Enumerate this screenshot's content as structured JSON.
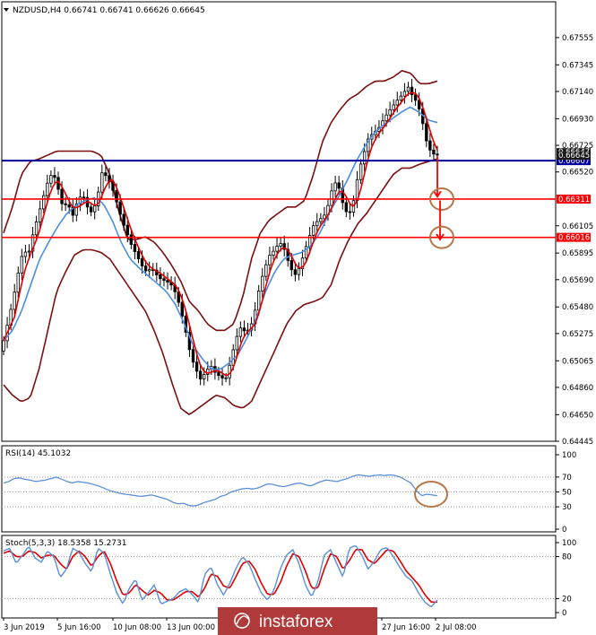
{
  "header": {
    "symbol_line": "NZDUSD,H4  0.66741 0.66741 0.66626 0.66645",
    "rsi_label": "RSI(14) 45.1032",
    "stoch_label": "Stoch(5,3,3) 18.5358 15.2731"
  },
  "watermark": "instaforex",
  "colors": {
    "candle": "#000000",
    "bollinger": "#7a1010",
    "ma_fast": "#e00000",
    "ma_slow": "#4a8fe0",
    "level_blue": "#00009c",
    "level_red": "#ff0000",
    "rsi_line": "#5b8fd8",
    "stoch_main": "#5b8fd8",
    "stoch_signal": "#e00000",
    "annotation": "#b5774a",
    "watermark_bg": "#b03a3a"
  },
  "chart_data": [
    {
      "type": "candlestick",
      "title": "NZDUSD,H4",
      "ylim": [
        0.64445,
        0.67665
      ],
      "y_ticks": [
        "0.67555",
        "0.67345",
        "0.67140",
        "0.66930",
        "0.66725",
        "0.66520",
        "0.66105",
        "0.65895",
        "0.65690",
        "0.65480",
        "0.65275",
        "0.65065",
        "0.64860",
        "0.64650",
        "0.64445"
      ],
      "x_ticks": [
        "3 Jun 2019",
        "5 Jun 16:00",
        "10 Jun 08:00",
        "13 Jun 00:00",
        "27 Jun 16:00",
        "2 Jul 08:00"
      ],
      "current_price": [
        "0.66647",
        "0.66645"
      ],
      "levels": [
        {
          "label": "0.66607",
          "price": 0.66607,
          "color": "blue"
        },
        {
          "label": "0.66311",
          "price": 0.66311,
          "color": "red"
        },
        {
          "label": "0.66016",
          "price": 0.66016,
          "color": "red"
        }
      ],
      "close_path": [
        0.6522,
        0.6538,
        0.6555,
        0.6575,
        0.6592,
        0.6588,
        0.6605,
        0.6618,
        0.6632,
        0.6645,
        0.6652,
        0.664,
        0.6625,
        0.6628,
        0.6618,
        0.663,
        0.6635,
        0.6625,
        0.662,
        0.6632,
        0.6652,
        0.6648,
        0.664,
        0.6628,
        0.6615,
        0.6605,
        0.6595,
        0.6588,
        0.658,
        0.6575,
        0.6578,
        0.6573,
        0.6569,
        0.6568,
        0.6565,
        0.6558,
        0.6545,
        0.6528,
        0.651,
        0.65,
        0.6492,
        0.6498,
        0.6503,
        0.6497,
        0.6494,
        0.6492,
        0.6505,
        0.6522,
        0.6532,
        0.6529,
        0.6531,
        0.6545,
        0.6565,
        0.6578,
        0.6588,
        0.6592,
        0.6598,
        0.6592,
        0.658,
        0.6572,
        0.6578,
        0.659,
        0.6602,
        0.6612,
        0.6615,
        0.6618,
        0.6628,
        0.6645,
        0.664,
        0.6625,
        0.6618,
        0.663,
        0.6652,
        0.6665,
        0.6678,
        0.6682,
        0.6685,
        0.6692,
        0.6698,
        0.6703,
        0.6708,
        0.6712,
        0.6718,
        0.671,
        0.6705,
        0.669,
        0.6672,
        0.6666,
        0.6665
      ],
      "bb_upper_path": [
        0.6605,
        0.6625,
        0.665,
        0.666,
        0.6662,
        0.6665,
        0.6668,
        0.6668,
        0.6668,
        0.6668,
        0.6668,
        0.6665,
        0.665,
        0.6622,
        0.66,
        0.66,
        0.6602,
        0.6598,
        0.659,
        0.658,
        0.6568,
        0.6552,
        0.6545,
        0.6535,
        0.653,
        0.653,
        0.6535,
        0.6555,
        0.6585,
        0.6605,
        0.6615,
        0.662,
        0.6625,
        0.6625,
        0.663,
        0.665,
        0.6675,
        0.669,
        0.67,
        0.6708,
        0.6712,
        0.6718,
        0.6722,
        0.6722,
        0.6725,
        0.673,
        0.6728,
        0.672,
        0.672,
        0.6722
      ],
      "bb_lower_path": [
        0.6488,
        0.648,
        0.6475,
        0.6478,
        0.65,
        0.653,
        0.656,
        0.6575,
        0.6588,
        0.6592,
        0.6592,
        0.659,
        0.6585,
        0.6575,
        0.6565,
        0.6555,
        0.6545,
        0.653,
        0.6512,
        0.649,
        0.647,
        0.6465,
        0.647,
        0.6475,
        0.648,
        0.6478,
        0.6472,
        0.647,
        0.6475,
        0.649,
        0.6505,
        0.652,
        0.6535,
        0.6545,
        0.655,
        0.6552,
        0.6555,
        0.6565,
        0.6585,
        0.66,
        0.6612,
        0.662,
        0.663,
        0.664,
        0.665,
        0.6655,
        0.6655,
        0.6658,
        0.666,
        0.6662
      ],
      "ma_slow_path": [
        0.6522,
        0.653,
        0.6545,
        0.6565,
        0.6585,
        0.6598,
        0.661,
        0.662,
        0.6626,
        0.663,
        0.6632,
        0.6628,
        0.6615,
        0.6598,
        0.6585,
        0.6578,
        0.6572,
        0.6566,
        0.656,
        0.655,
        0.6535,
        0.6518,
        0.6508,
        0.65,
        0.65,
        0.6505,
        0.6512,
        0.6525,
        0.654,
        0.656,
        0.6575,
        0.6585,
        0.6588,
        0.659,
        0.6595,
        0.6605,
        0.662,
        0.6632,
        0.6645,
        0.666,
        0.6672,
        0.6682,
        0.6688,
        0.6693,
        0.6698,
        0.6702,
        0.6698,
        0.6692,
        0.669
      ],
      "arrows": [
        {
          "from_price": 0.6664,
          "to_price": 0.6633,
          "circle_price": 0.66311
        },
        {
          "from_price": 0.663,
          "to_price": 0.66,
          "circle_price": 0.66016
        }
      ]
    },
    {
      "type": "line",
      "title": "RSI(14)",
      "ylim": [
        0,
        100
      ],
      "y_ticks": [
        "100",
        "70",
        "50",
        "30",
        "0"
      ],
      "levels": [
        70,
        50,
        30
      ],
      "values": [
        62,
        64,
        68,
        69,
        67,
        66,
        64,
        65,
        66,
        68,
        70,
        67,
        64,
        62,
        64,
        63,
        62,
        60,
        58,
        55,
        52,
        50,
        48,
        47,
        46,
        45,
        44,
        45,
        46,
        44,
        42,
        40,
        36,
        34,
        35,
        32,
        31,
        33,
        36,
        38,
        40,
        44,
        46,
        50,
        52,
        54,
        55,
        54,
        55,
        58,
        61,
        60,
        58,
        57,
        59,
        61,
        62,
        60,
        58,
        61,
        64,
        66,
        65,
        64,
        66,
        68,
        71,
        73,
        72,
        71,
        72,
        73,
        72,
        73,
        72,
        70,
        66,
        62,
        52,
        45,
        47,
        46,
        45
      ]
    },
    {
      "type": "line",
      "title": "Stoch(5,3,3)",
      "ylim": [
        0,
        100
      ],
      "y_ticks": [
        "100",
        "80",
        "20",
        "0"
      ],
      "levels": [
        80,
        20
      ],
      "series": [
        {
          "values": [
            88,
            92,
            70,
            82,
            95,
            78,
            72,
            88,
            80,
            50,
            62,
            92,
            86,
            70,
            58,
            92,
            85,
            55,
            28,
            12,
            35,
            48,
            18,
            28,
            40,
            12,
            16,
            20,
            30,
            34,
            26,
            14,
            55,
            65,
            40,
            25,
            42,
            64,
            80,
            70,
            48,
            28,
            18,
            32,
            62,
            82,
            90,
            70,
            40,
            22,
            44,
            82,
            90,
            70,
            50,
            92,
            96,
            82,
            62,
            74,
            90,
            93,
            80,
            65,
            52,
            45,
            28,
            15,
            8,
            18
          ]
        },
        {
          "values": [
            85,
            88,
            80,
            80,
            88,
            86,
            78,
            82,
            82,
            70,
            62,
            80,
            88,
            80,
            66,
            80,
            88,
            70,
            45,
            25,
            28,
            40,
            32,
            25,
            32,
            28,
            18,
            18,
            24,
            30,
            30,
            22,
            35,
            55,
            52,
            38,
            35,
            52,
            70,
            74,
            62,
            42,
            26,
            26,
            42,
            66,
            84,
            80,
            60,
            35,
            35,
            62,
            84,
            80,
            62,
            74,
            90,
            90,
            75,
            70,
            80,
            90,
            88,
            75,
            60,
            50,
            40,
            26,
            15,
            15
          ]
        }
      ]
    }
  ]
}
